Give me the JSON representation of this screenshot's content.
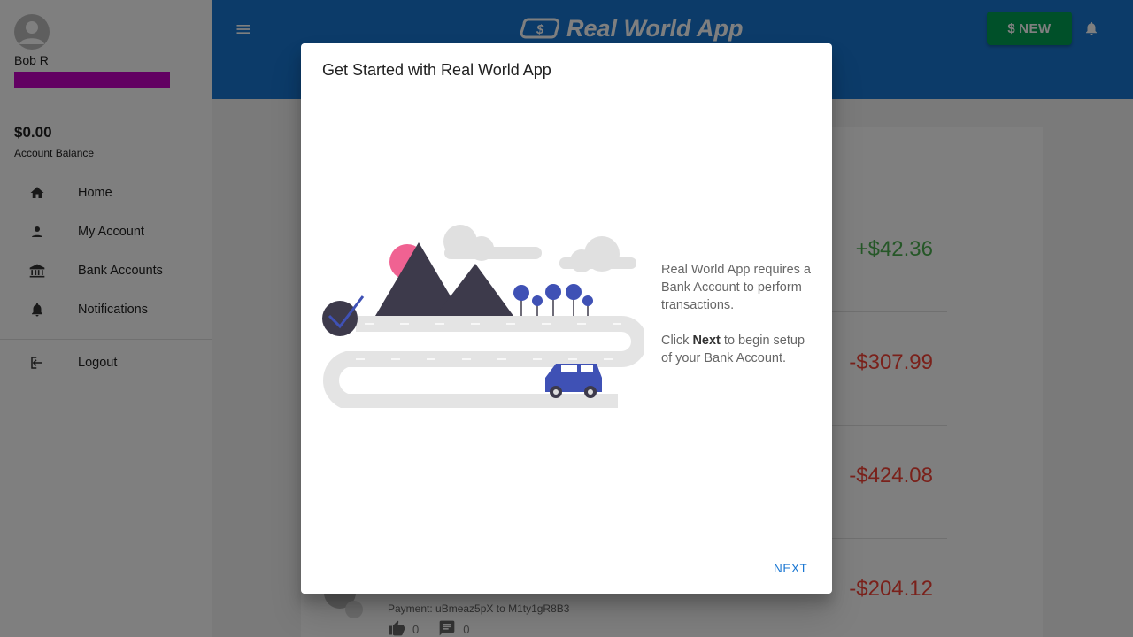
{
  "sidebar": {
    "user_name": "Bob R",
    "balance": "$0.00",
    "balance_label": "Account Balance",
    "items": [
      {
        "label": "Home",
        "icon": "home-icon"
      },
      {
        "label": "My Account",
        "icon": "person-icon"
      },
      {
        "label": "Bank Accounts",
        "icon": "bank-icon"
      },
      {
        "label": "Notifications",
        "icon": "bell-icon"
      },
      {
        "label": "Logout",
        "icon": "logout-icon"
      }
    ]
  },
  "header": {
    "app_title": "Real World App",
    "new_button": "NEW"
  },
  "transactions": [
    {
      "amount": "+$42.36",
      "type": "positive"
    },
    {
      "amount": "-$307.99",
      "type": "negative"
    },
    {
      "amount": "-$424.08",
      "type": "negative"
    },
    {
      "amount": "-$204.12",
      "type": "negative",
      "description": "Payment: uBmeaz5pX to M1ty1gR8B3",
      "likes": "0",
      "comments": "0"
    }
  ],
  "dialog": {
    "title": "Get Started with Real World App",
    "text1": "Real World App requires a Bank Account to perform transactions.",
    "text2_prefix": "Click ",
    "text2_bold": "Next",
    "text2_suffix": " to begin setup of your Bank Account.",
    "next_button": "NEXT"
  },
  "colors": {
    "primary": "#1976d2",
    "new_button": "#00a152",
    "positive": "#4caf50",
    "negative": "#f44336",
    "username_highlight": "#c400c4"
  }
}
